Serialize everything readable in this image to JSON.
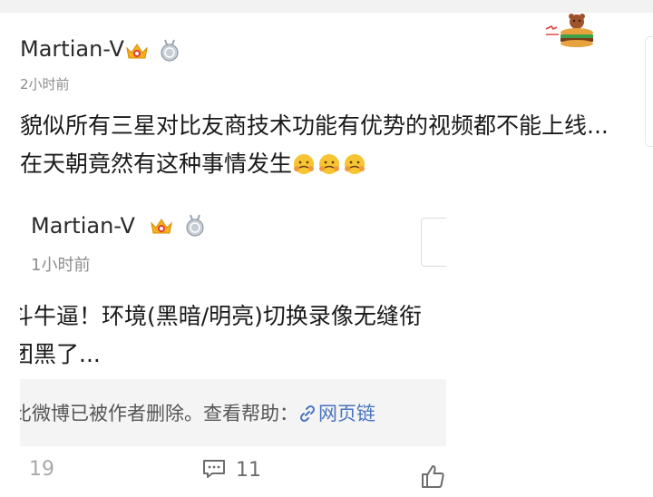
{
  "post": {
    "author": "Martian-V",
    "time": "2小时前",
    "text_line1": "貌似所有三星对比友商技术功能有优势的视频都不能上线...",
    "text_line2": "在天朝竟然有这种事情发生"
  },
  "repost": {
    "author": "Martian-V",
    "time": "1小时前",
    "text_line1": "斗牛逼！环境(黑暗/明亮)切换录像无缝衔",
    "text_line2": "团黑了...",
    "deleted_notice": "比微博已被作者删除。查看帮助：",
    "link_label": "网页链"
  },
  "actions": {
    "repost_count": "19",
    "comment_count": "11"
  },
  "icons": {
    "vip_badge": "vip-crown-icon",
    "medal_badge": "medal-icon",
    "emoji": "face-emoji-icon",
    "link": "link-icon",
    "comment": "comment-icon",
    "like": "thumbs-up-icon",
    "sticker": "bear-burger-sticker"
  },
  "colors": {
    "link": "#4a74c0",
    "deleted_bg": "#f4f4f4",
    "vip": "#f6b21a",
    "muted": "#8c8c8c"
  }
}
